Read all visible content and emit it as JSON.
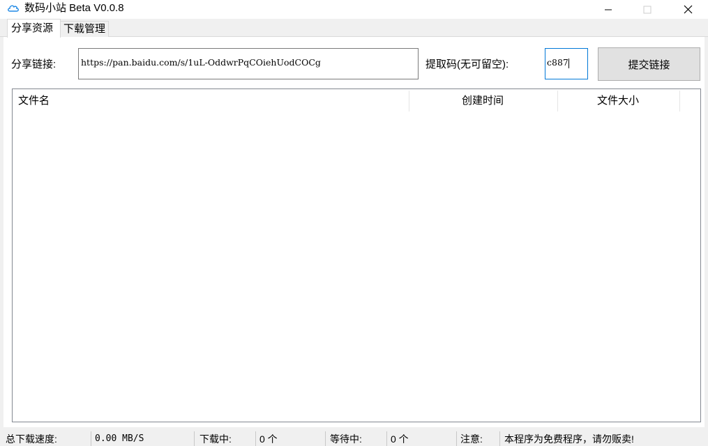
{
  "window": {
    "title": "数码小站 Beta V0.0.8",
    "icon": "cloud-icon",
    "controls": [
      "minimize-icon",
      "maximize-icon",
      "close-icon"
    ]
  },
  "tabs": [
    {
      "label": "分享资源",
      "active": true
    },
    {
      "label": "下载管理",
      "active": false
    }
  ],
  "share": {
    "link_label": "分享链接:",
    "link_value": "https://pan.baidu.com/s/1uL-OddwrPqCOiehUodCOCg",
    "code_label": "提取码(无可留空):",
    "code_value": "c887",
    "submit_label": "提交链接"
  },
  "file_list": {
    "columns": [
      "文件名",
      "创建时间",
      "文件大小"
    ],
    "rows": []
  },
  "status": {
    "speed_label": "总下载速度:",
    "speed_value": "0.00 MB/S",
    "downloading_label": "下载中:",
    "downloading_value": "0 个",
    "waiting_label": "等待中:",
    "waiting_value": "0 个",
    "notice_label": "注意:",
    "notice_value": "本程序为免费程序，请勿贩卖!"
  },
  "colors": {
    "focus_border": "#0078d7",
    "icon_blue": "#1e88e5",
    "button_bg": "#e1e1e1"
  }
}
